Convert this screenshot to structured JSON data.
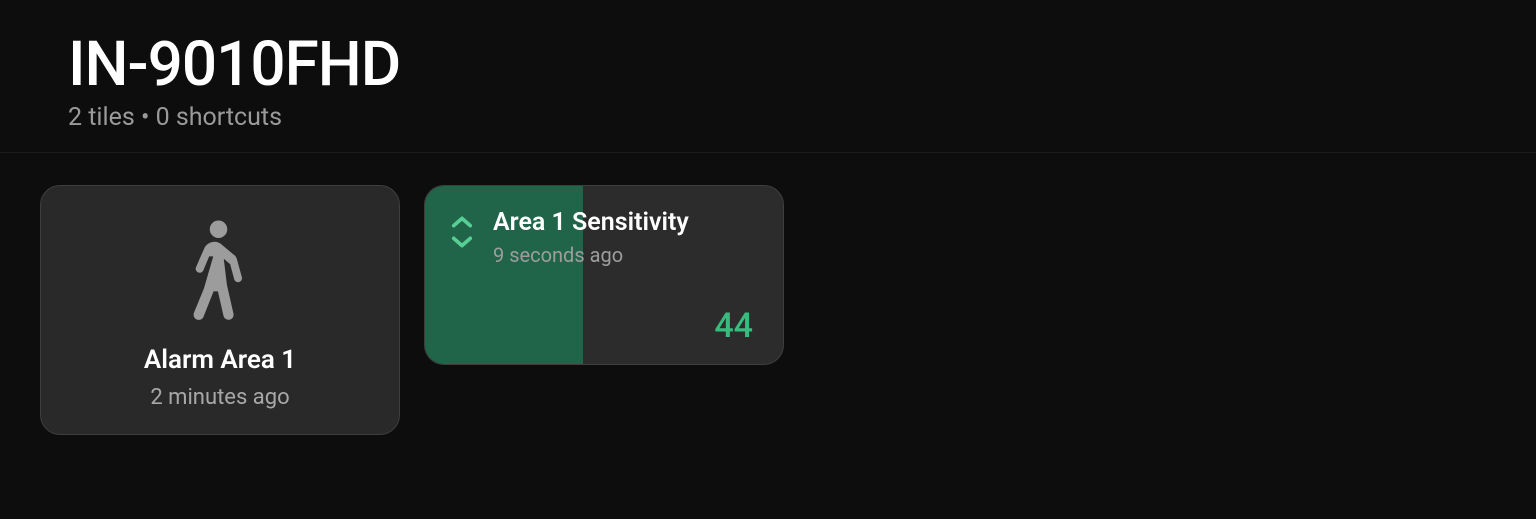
{
  "header": {
    "title": "IN-9010FHD",
    "subtitle": "2 tiles • 0 shortcuts"
  },
  "tiles": {
    "motion": {
      "label": "Alarm Area 1",
      "time": "2 minutes ago"
    },
    "sensitivity": {
      "label": "Area 1 Sensitivity",
      "time": "9 seconds ago",
      "value": "44",
      "fillPercent": "44"
    }
  },
  "colors": {
    "accent": "#36bd7e",
    "fill": "#20644a",
    "bg": "#0d0d0d"
  }
}
